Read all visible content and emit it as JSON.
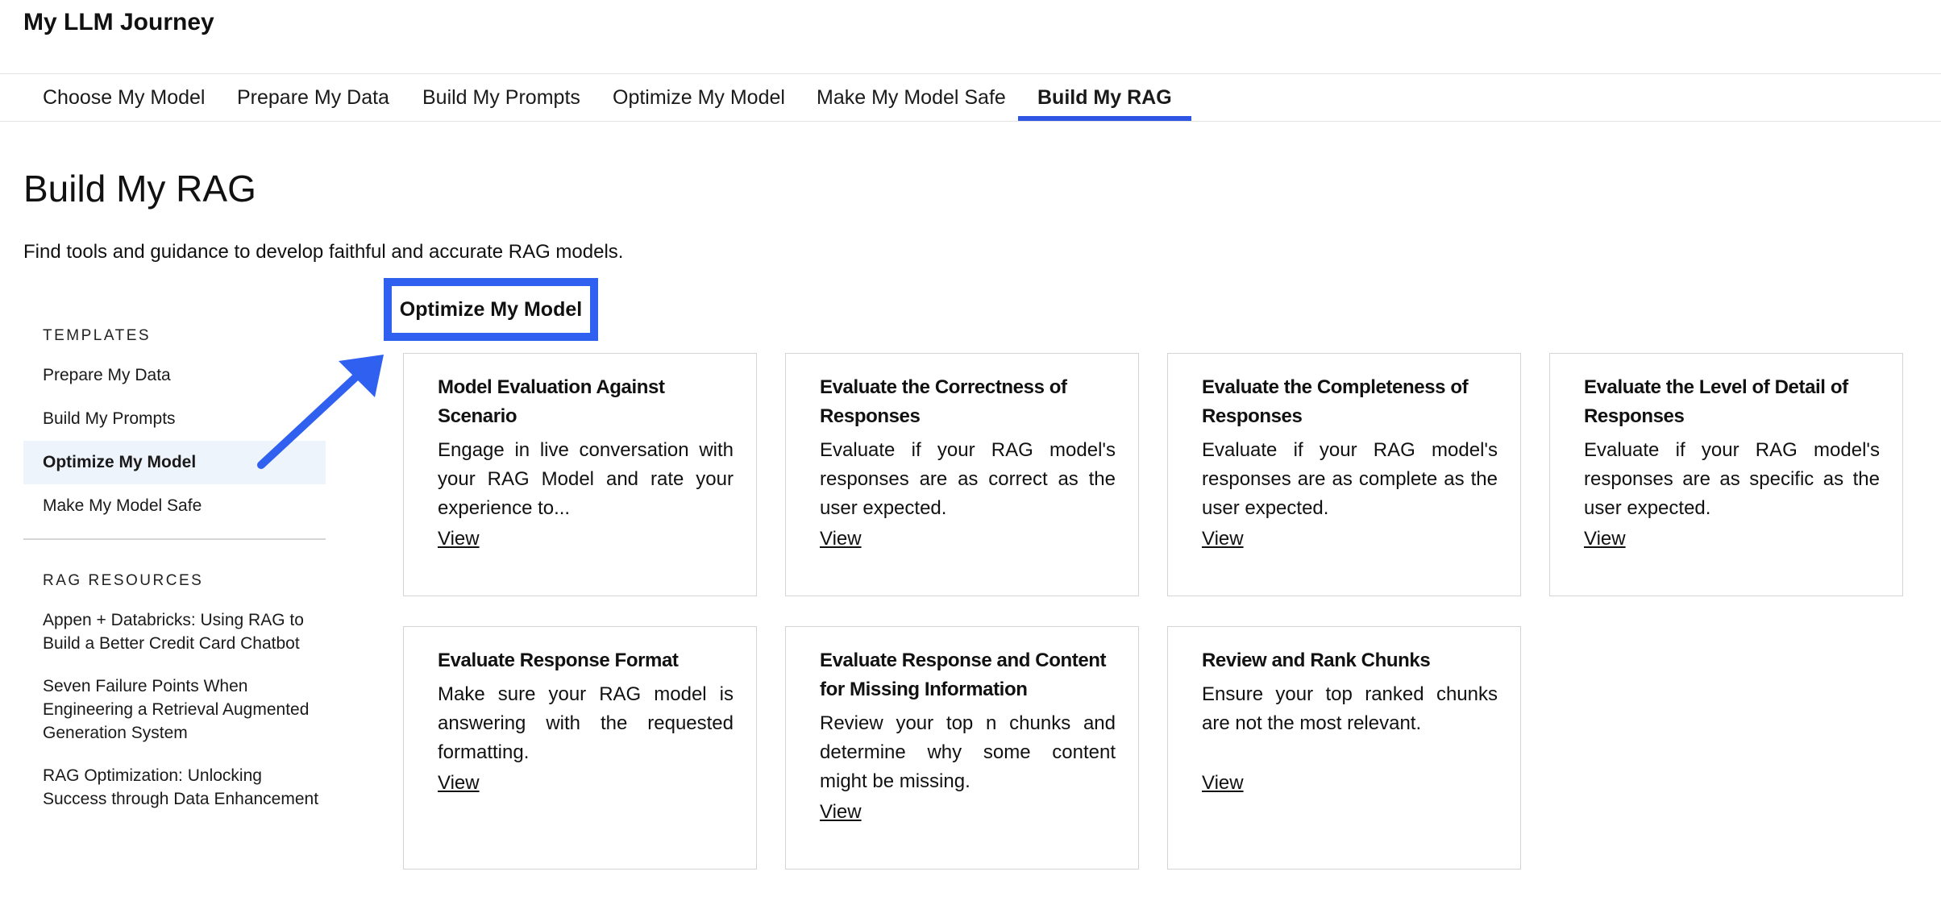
{
  "app": {
    "title": "My LLM Journey"
  },
  "tabs": [
    {
      "label": "Choose My Model",
      "active": false
    },
    {
      "label": "Prepare My Data",
      "active": false
    },
    {
      "label": "Build My Prompts",
      "active": false
    },
    {
      "label": "Optimize My Model",
      "active": false
    },
    {
      "label": "Make My Model Safe",
      "active": false
    },
    {
      "label": "Build My RAG",
      "active": true
    }
  ],
  "page": {
    "title": "Build My RAG",
    "subtitle": "Find tools and guidance to develop faithful and accurate RAG models."
  },
  "sidebar": {
    "templates_heading": "TEMPLATES",
    "templates": [
      {
        "label": "Prepare My Data",
        "active": false
      },
      {
        "label": "Build My Prompts",
        "active": false
      },
      {
        "label": "Optimize My Model",
        "active": true
      },
      {
        "label": "Make My Model Safe",
        "active": false
      }
    ],
    "resources_heading": "RAG RESOURCES",
    "resources": [
      {
        "label": "Appen + Databricks: Using RAG to Build a Better Credit Card Chatbot"
      },
      {
        "label": "Seven Failure Points When Engineering a Retrieval Augmented Generation System"
      },
      {
        "label": "RAG Optimization: Unlocking Success through Data Enhancement"
      }
    ]
  },
  "section": {
    "title": "Optimize My Model"
  },
  "cards": [
    {
      "title": "Model Evaluation Against Scenario",
      "description": "Engage in live conversation with your RAG Model and rate your experience to...",
      "link": "View"
    },
    {
      "title": "Evaluate the Correctness of Responses",
      "description": "Evaluate if your RAG model's responses are as correct as the user expected.",
      "link": "View"
    },
    {
      "title": "Evaluate the Completeness of Responses",
      "description": "Evaluate if your RAG model's responses are as complete as the user expected.",
      "link": "View"
    },
    {
      "title": "Evaluate the Level of Detail of Responses",
      "description": "Evaluate if your RAG model's responses are as specific as the user expected.",
      "link": "View"
    },
    {
      "title": "Evaluate Response Format",
      "description": "Make sure your RAG model is answering with the requested formatting.",
      "link": "View"
    },
    {
      "title": "Evaluate Response and Content for Missing Information",
      "description": "Review your top n chunks and determine why some content might be missing.",
      "link": "View"
    },
    {
      "title": "Review and Rank Chunks",
      "description": "Ensure your top ranked chunks are not the most relevant.",
      "link": "View"
    }
  ],
  "colors": {
    "accent": "#2f60f0",
    "tab_underline": "#2f55e4",
    "active_sidebar_bg": "#eef4fb",
    "card_border": "#d4d4d4"
  }
}
